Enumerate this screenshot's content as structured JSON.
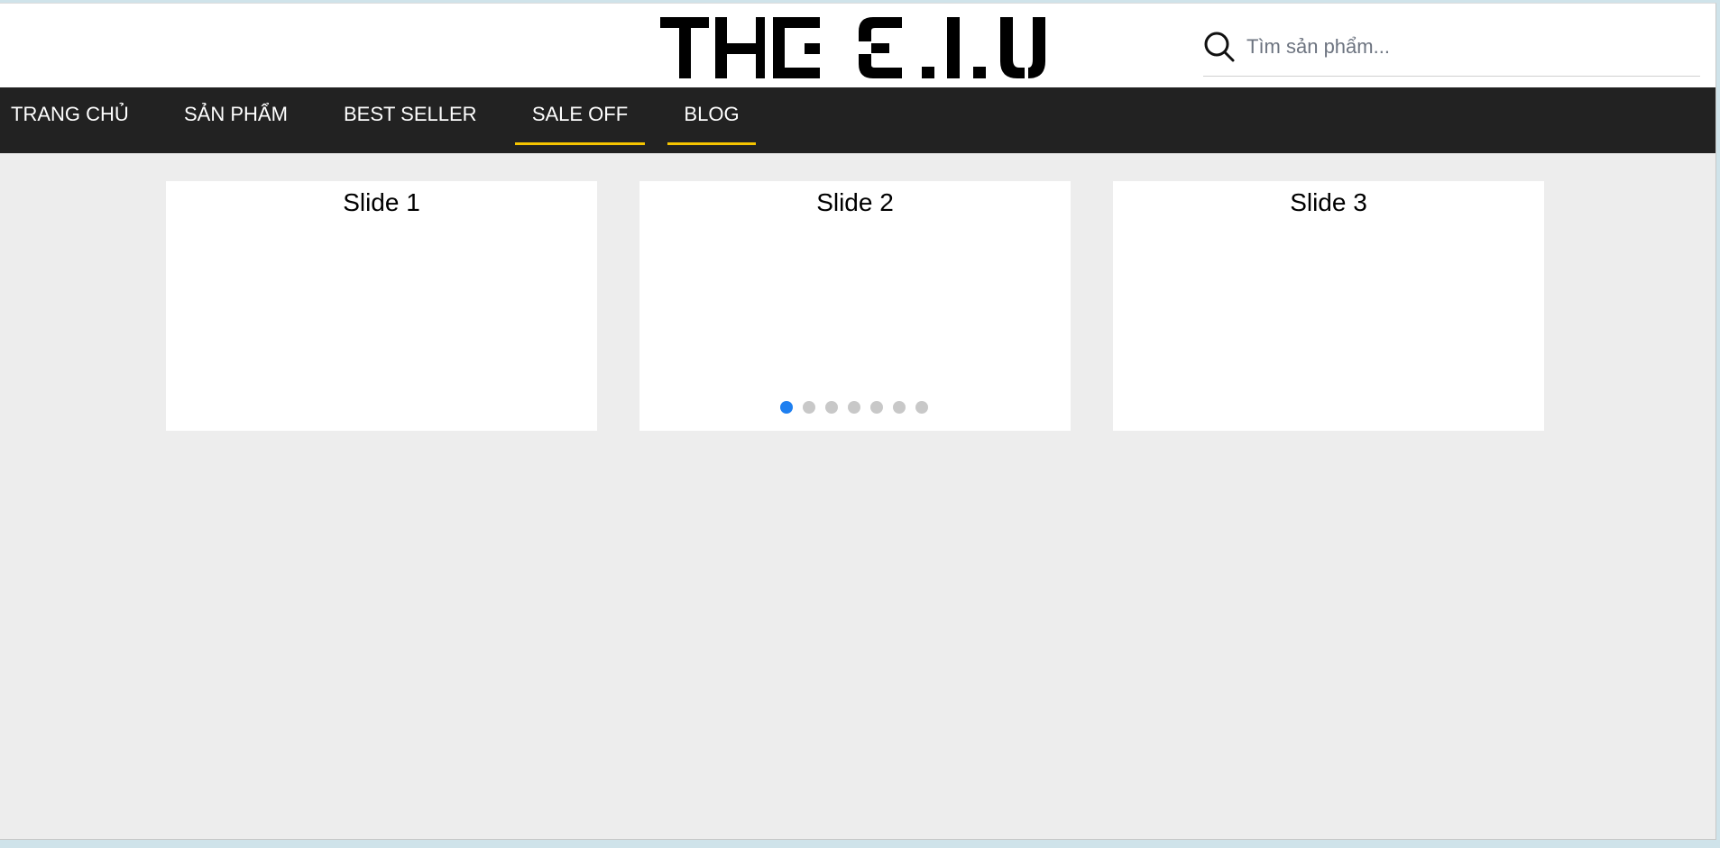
{
  "header": {
    "logo_text": "THE C.I.U",
    "search": {
      "placeholder": "Tìm sản phẩm...",
      "value": ""
    }
  },
  "nav": {
    "items": [
      {
        "label": "TRANG CHỦ"
      },
      {
        "label": "SẢN PHẨM"
      },
      {
        "label": "BEST SELLER"
      },
      {
        "label": "SALE OFF"
      },
      {
        "label": "BLOG"
      }
    ],
    "underline_color": "#f5c400"
  },
  "slider": {
    "slides": [
      {
        "label": "Slide 1"
      },
      {
        "label": "Slide 2"
      },
      {
        "label": "Slide 3"
      }
    ],
    "pagination_count": 7,
    "active_index": 0,
    "active_color": "#1e7ff0"
  },
  "colors": {
    "nav_background": "#222222",
    "page_background": "#ededed"
  },
  "icons": {
    "search": "search-icon"
  }
}
